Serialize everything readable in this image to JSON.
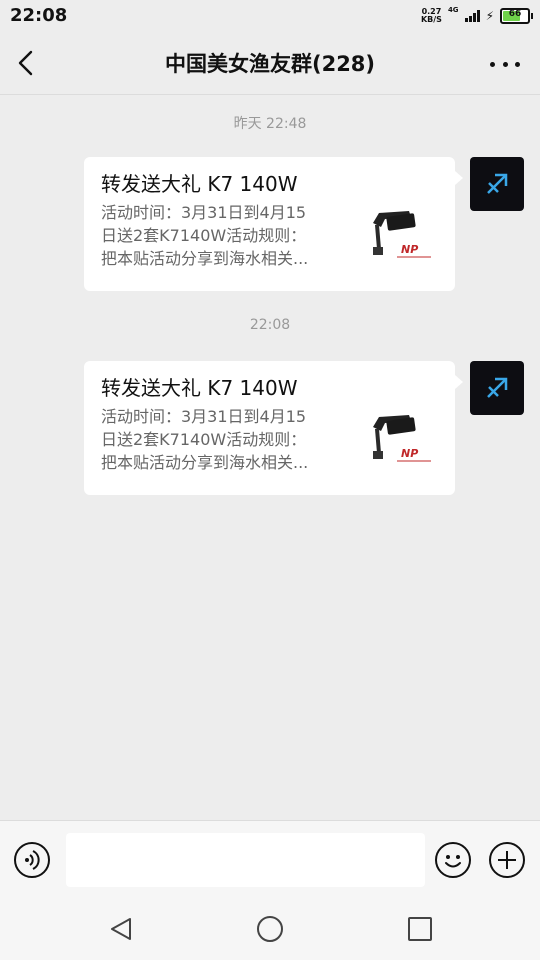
{
  "status_bar": {
    "time": "22:08",
    "net_speed_value": "0.27",
    "net_speed_unit": "KB/S",
    "network_type": "4G",
    "battery_level": "66"
  },
  "header": {
    "title": "中国美女渔友群(228)"
  },
  "messages": [
    {
      "timestamp": "昨天 22:48",
      "card_title": "转发送大礼 K7 140W",
      "desc_lines": [
        "活动时间：3月31日到4月15",
        "日送2套K7140W活动规则：",
        "把本贴活动分享到海水相关..."
      ],
      "thumb_brand": "NP"
    },
    {
      "timestamp": "22:08",
      "card_title": "转发送大礼 K7 140W",
      "desc_lines": [
        "活动时间：3月31日到4月15",
        "日送2套K7140W活动规则：",
        "把本贴活动分享到海水相关..."
      ],
      "thumb_brand": "NP"
    }
  ],
  "input_bar": {
    "text_value": "",
    "voice_icon": "voice-icon",
    "emoji_icon": "emoji-icon",
    "plus_icon": "plus-icon"
  },
  "colors": {
    "background": "#ededed",
    "bubble": "#ffffff",
    "timestamp": "#999999",
    "avatar_accent": "#3aa7e8"
  }
}
